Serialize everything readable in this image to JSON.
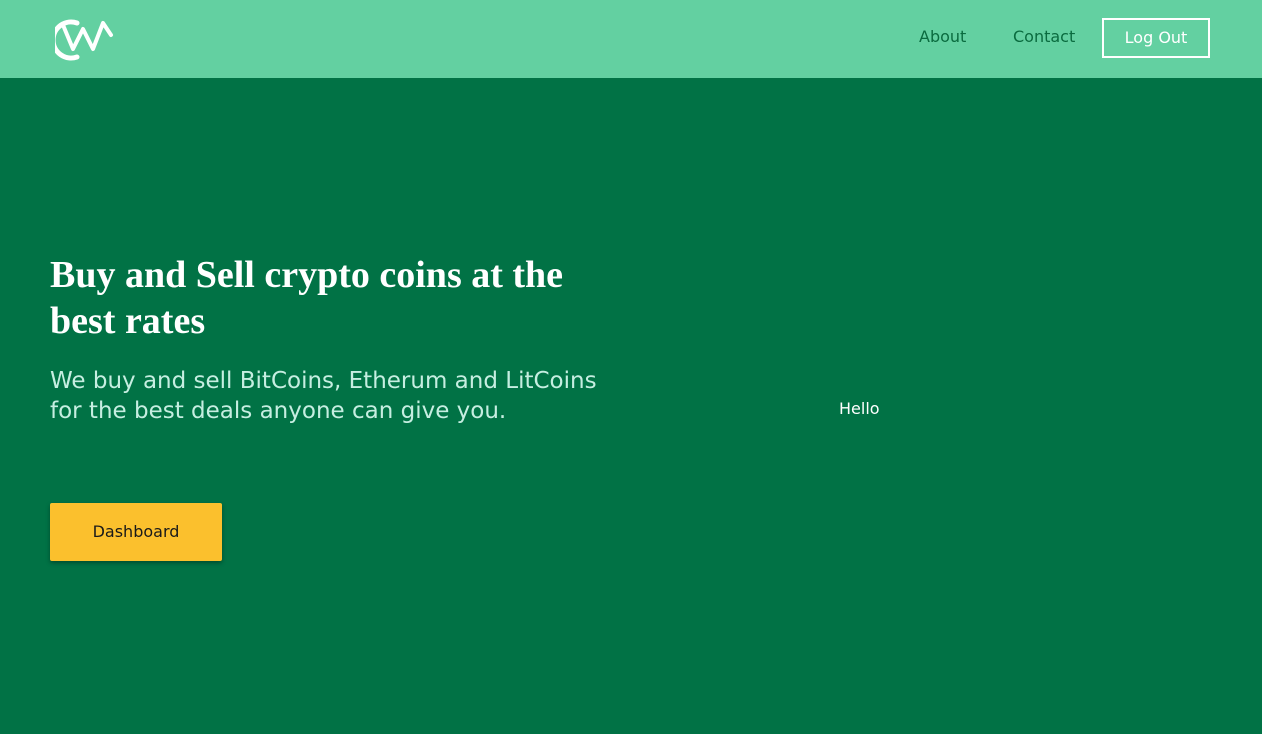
{
  "header": {
    "logo_icon": "cw-logo-icon",
    "nav": {
      "about": "About",
      "contact": "Contact",
      "logout": "Log Out"
    }
  },
  "hero": {
    "title": "Buy and Sell crypto coins at the best rates",
    "subtitle": "We buy and sell BitCoins, Etherum and LitCoins for the best deals anyone can give you.",
    "cta_label": "Dashboard"
  },
  "side": {
    "text": "Hello"
  },
  "colors": {
    "header_bg": "#63d0a1",
    "main_bg": "#017245",
    "accent": "#fbc02d",
    "text": "#ffffff"
  }
}
